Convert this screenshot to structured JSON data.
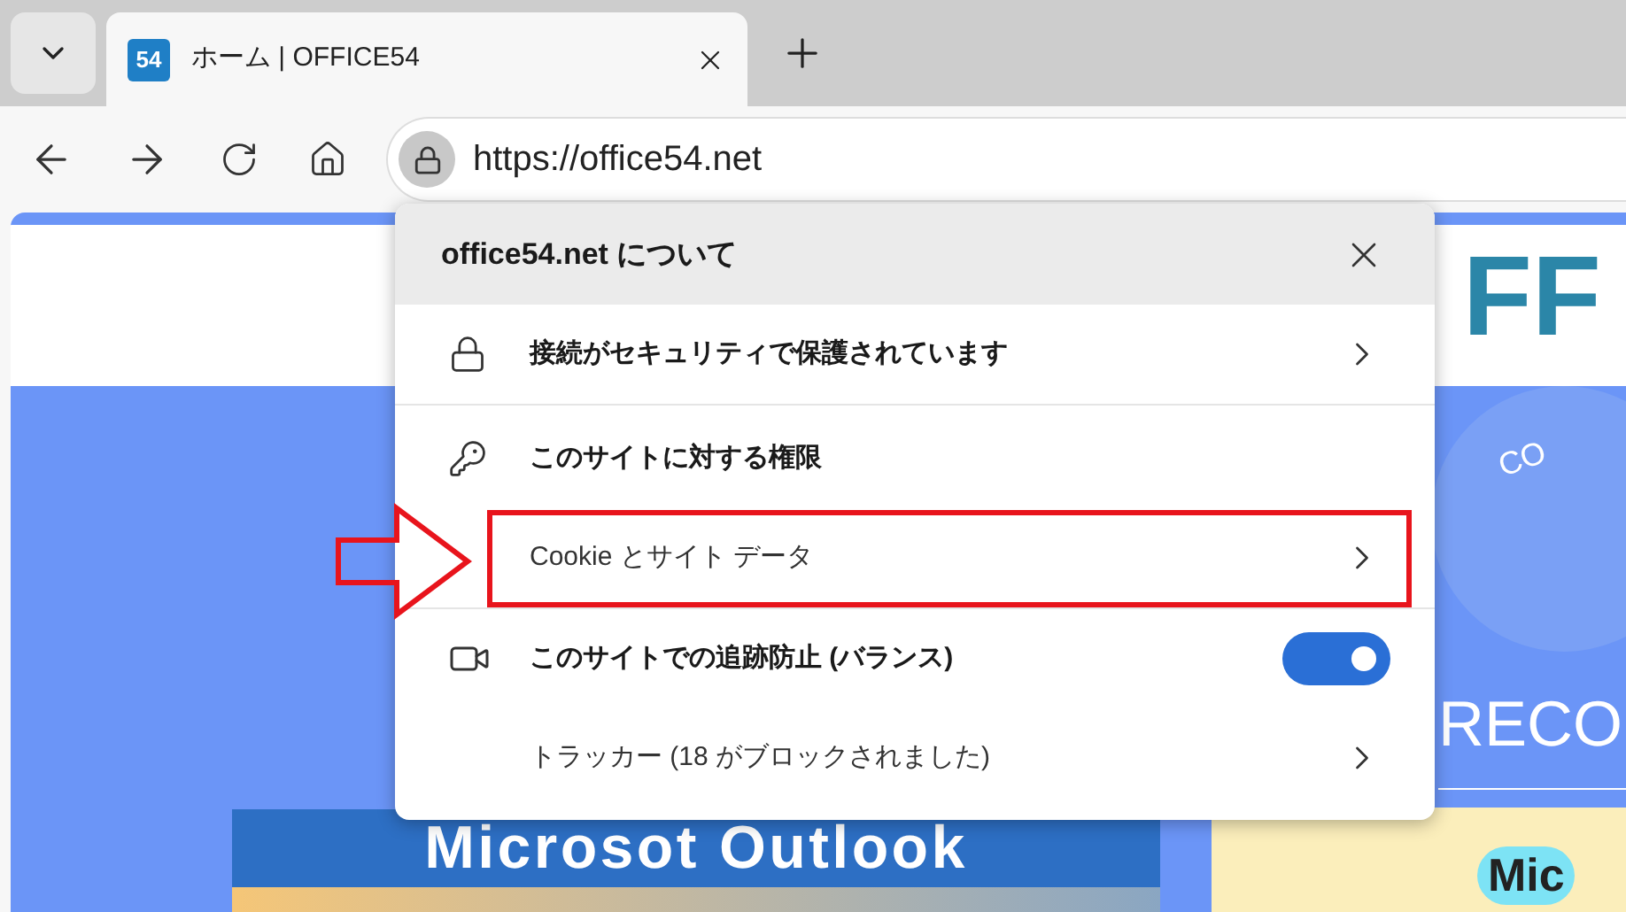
{
  "browser": {
    "favicon": "54",
    "tab_title": "ホーム | OFFICE54",
    "url": "https://office54.net"
  },
  "page": {
    "logo": "FF",
    "badge_text": "CO",
    "heading": "RECO",
    "banner": "Microsot Outlook",
    "card_text": "Mic"
  },
  "popup": {
    "title": "office54.net について",
    "items": [
      {
        "kind": "connection",
        "label": "接続がセキュリティで保護されています",
        "highlighted": false
      },
      {
        "kind": "permissions",
        "label": "このサイトに対する権限",
        "highlighted": false
      },
      {
        "kind": "cookies",
        "label": "Cookie とサイト データ",
        "highlighted": true
      },
      {
        "kind": "tracking",
        "label": "このサイトでの追跡防止 (バランス)",
        "on": true,
        "highlighted": false
      },
      {
        "kind": "trackers",
        "label": "トラッカー (18 がブロックされました)",
        "highlighted": false
      }
    ]
  }
}
